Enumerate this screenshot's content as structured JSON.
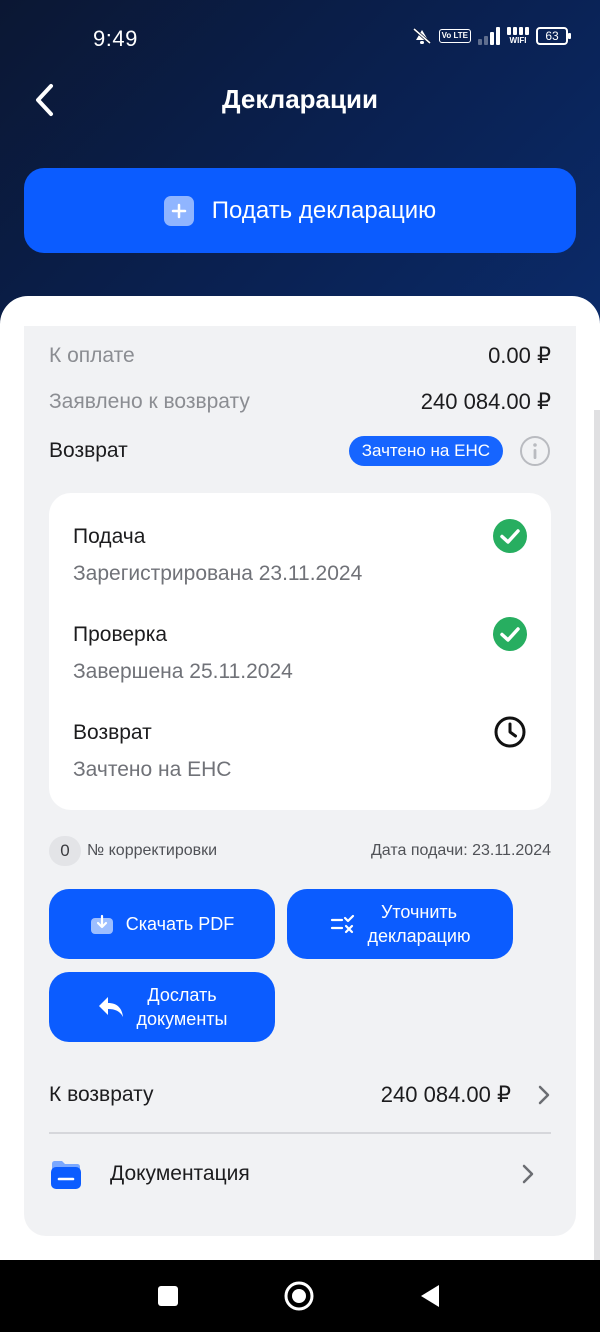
{
  "status_bar": {
    "time": "9:49",
    "volte": "Vo LTE",
    "wifi": "WIFI",
    "battery": "63"
  },
  "header": {
    "title": "Декларации",
    "back_icon": "chevron-left-icon"
  },
  "submit_button": {
    "label": "Подать декларацию",
    "icon": "plus-icon"
  },
  "summary": {
    "to_pay_label": "К оплате",
    "to_pay_value": "0.00 ₽",
    "refund_claimed_label": "Заявлено к возврату",
    "refund_claimed_value": "240 084.00 ₽",
    "refund_label": "Возврат",
    "refund_badge": "Зачтено на ЕНС"
  },
  "timeline": [
    {
      "title": "Подача",
      "subtitle": "Зарегистрирована 23.11.2024",
      "status": "done"
    },
    {
      "title": "Проверка",
      "subtitle": "Завершена 25.11.2024",
      "status": "done"
    },
    {
      "title": "Возврат",
      "subtitle": "Зачтено на ЕНС",
      "status": "pending"
    }
  ],
  "meta": {
    "correction_count": "0",
    "correction_label": "№ корректировки",
    "submission_date": "Дата подачи: 23.11.2024"
  },
  "actions": {
    "download_pdf": "Скачать PDF",
    "clarify_line1": "Уточнить",
    "clarify_line2": "декларацию",
    "send_docs_line1": "Дослать",
    "send_docs_line2": "документы"
  },
  "links": {
    "refund_label": "К возврату",
    "refund_value": "240 084.00 ₽",
    "documentation_label": "Документация"
  },
  "colors": {
    "accent": "#0b5cff",
    "success": "#27ae60",
    "header_bg": "#0a2152"
  }
}
